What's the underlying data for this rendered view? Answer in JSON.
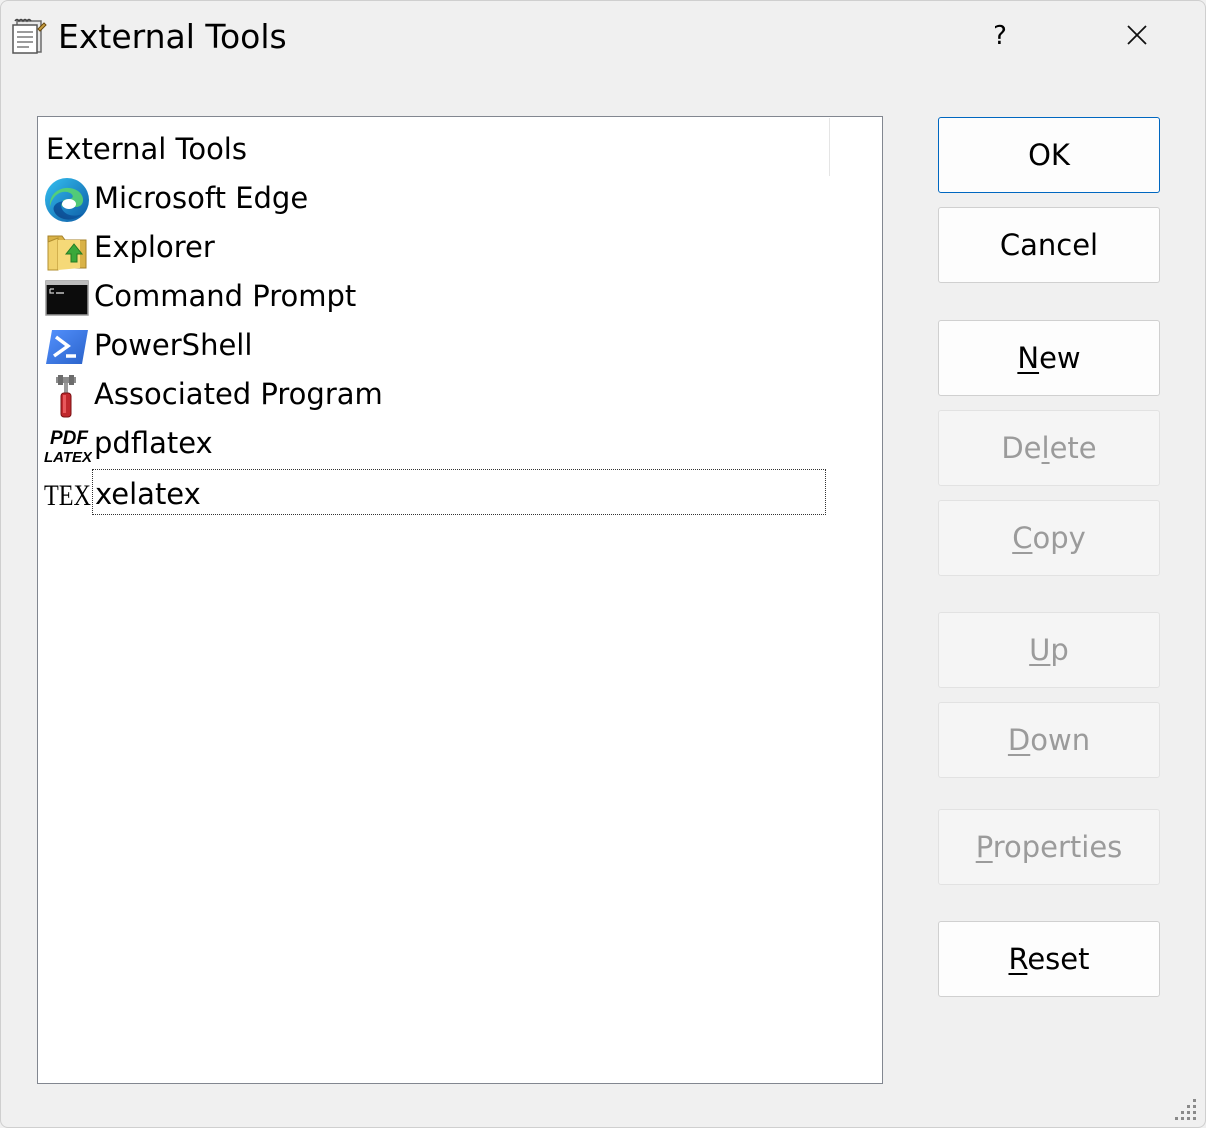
{
  "window": {
    "title": "External Tools",
    "help_label": "?",
    "close_icon": "close-icon",
    "title_icon": "notepad-icon"
  },
  "list": {
    "header": "External Tools",
    "items": [
      {
        "label": "Microsoft Edge",
        "icon": "edge-icon"
      },
      {
        "label": "Explorer",
        "icon": "explorer-icon"
      },
      {
        "label": "Command Prompt",
        "icon": "command-prompt-icon"
      },
      {
        "label": "PowerShell",
        "icon": "powershell-icon"
      },
      {
        "label": "Associated Program",
        "icon": "tools-icon"
      },
      {
        "label": "pdflatex",
        "icon": "pdflatex-icon",
        "icon_text_1": "PDF",
        "icon_text_2": "LATEX"
      },
      {
        "label": "xelatex",
        "icon": "tex-icon",
        "icon_text": "TEX",
        "focused": true
      }
    ]
  },
  "buttons": {
    "ok": {
      "label": "OK",
      "enabled": true
    },
    "cancel": {
      "label": "Cancel",
      "enabled": true
    },
    "new": {
      "pre": "",
      "key": "N",
      "post": "ew",
      "enabled": true
    },
    "delete": {
      "pre": "De",
      "key": "l",
      "post": "ete",
      "enabled": false
    },
    "copy": {
      "pre": "",
      "key": "C",
      "post": "opy",
      "enabled": false
    },
    "up": {
      "pre": "",
      "key": "U",
      "post": "p",
      "enabled": false
    },
    "down": {
      "pre": "",
      "key": "D",
      "post": "own",
      "enabled": false
    },
    "properties": {
      "pre": "",
      "key": "P",
      "post": "roperties",
      "enabled": false
    },
    "reset": {
      "pre": "",
      "key": "R",
      "post": "eset",
      "enabled": true
    }
  },
  "colors": {
    "accent": "#0067c0",
    "disabled_text": "#9b9b9b"
  }
}
